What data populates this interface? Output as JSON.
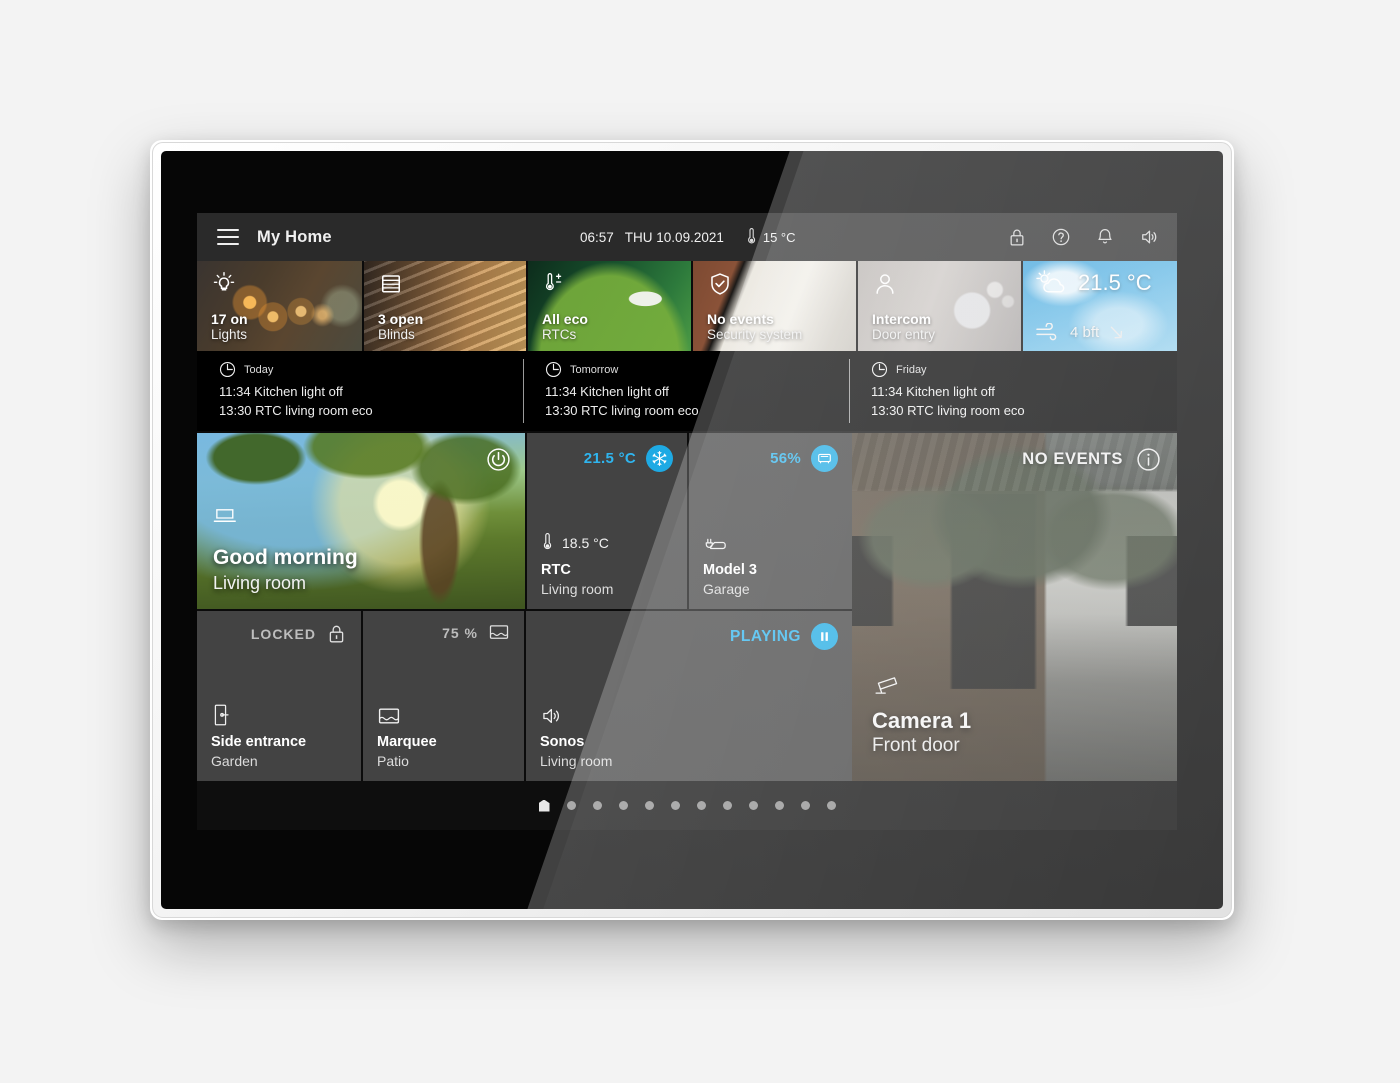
{
  "header": {
    "menu_icon": "hamburger-menu-icon",
    "title": "My Home",
    "time": "06:57",
    "date": "THU 10.09.2021",
    "outdoor_temp": "15 °C",
    "outdoor_icon": "thermometer-icon",
    "icons": [
      {
        "name": "lock-icon",
        "glyph": "lock"
      },
      {
        "name": "help-icon",
        "glyph": "question-circle"
      },
      {
        "name": "notification-bell-icon",
        "glyph": "bell"
      },
      {
        "name": "volume-icon",
        "glyph": "speaker"
      }
    ]
  },
  "quick_tiles": [
    {
      "icon": "lightbulb-icon",
      "status": "17 on",
      "label": "Lights",
      "theme": "bg-lights"
    },
    {
      "icon": "blinds-icon",
      "status": "3 open",
      "label": "Blinds",
      "theme": "bg-blinds"
    },
    {
      "icon": "thermostat-icon",
      "status": "All eco",
      "label": "RTCs",
      "theme": "bg-rtcs"
    },
    {
      "icon": "shield-check-icon",
      "status": "No events",
      "label": "Security system",
      "theme": "bg-secu"
    },
    {
      "icon": "person-icon",
      "status": "Intercom",
      "label": "Door entry",
      "theme": "bg-intercom"
    }
  ],
  "weather_tile": {
    "icon": "sun-cloud-icon",
    "temperature": "21.5 °C",
    "wind_icon": "wind-icon",
    "wind": "4 bft",
    "trend_icon": "arrow-down-right-icon"
  },
  "schedules": [
    {
      "icon": "clock-icon",
      "day": "Today",
      "events": [
        "11:34 Kitchen light off",
        "13:30 RTC living room eco"
      ]
    },
    {
      "icon": "clock-icon",
      "day": "Tomorrow",
      "events": [
        "11:34 Kitchen light off",
        "13:30 RTC living room eco"
      ]
    },
    {
      "icon": "clock-icon",
      "day": "Friday",
      "events": [
        "11:34 Kitchen light off",
        "13:30 RTC living room eco"
      ]
    }
  ],
  "scene_tile": {
    "title": "Good morning",
    "room": "Living room",
    "power_icon": "power-icon",
    "scene_icon": "scene-icon"
  },
  "control_tiles": [
    {
      "status_value": "21.5 °C",
      "status_accent": true,
      "badge_icon": "snowflake-icon",
      "current_icon": "thermometer-icon",
      "current_value": "18.5 °C",
      "icon": "",
      "name": "RTC",
      "room": "Living room"
    },
    {
      "status_value": "56%",
      "status_accent": true,
      "badge_icon": "ev-car-icon",
      "current_icon": "",
      "current_value": "",
      "icon": "ev-plug-icon",
      "name": "Model 3",
      "room": "Garage"
    },
    {
      "status_value": "LOCKED",
      "status_accent": false,
      "badge_icon": "lock-closed-icon",
      "current_icon": "",
      "current_value": "",
      "icon": "door-handle-icon",
      "name": "Side entrance",
      "room": "Garden"
    },
    {
      "status_value": "75 %",
      "status_accent": false,
      "badge_icon": "awning-icon",
      "current_icon": "",
      "current_value": "",
      "icon": "awning-icon",
      "name": "Marquee",
      "room": "Patio"
    },
    {
      "status_value": "PLAYING",
      "status_accent": true,
      "badge_icon": "pause-icon",
      "current_icon": "",
      "current_value": "",
      "icon": "speaker-icon",
      "name": "Sonos",
      "room": "Living room"
    }
  ],
  "camera": {
    "status": "NO EVENTS",
    "info_icon": "info-icon",
    "camera_icon": "cctv-camera-icon",
    "title": "Camera 1",
    "location": "Front door"
  },
  "pager": {
    "home_icon": "home-icon",
    "active_index": 0,
    "dot_count": 11
  },
  "colors": {
    "accent": "#1eaae4",
    "accent_text": "#2fb5ef",
    "tile_bg": "#434343",
    "header_bg": "#2a2a2a",
    "screen_bg": "#0b0b0b"
  }
}
